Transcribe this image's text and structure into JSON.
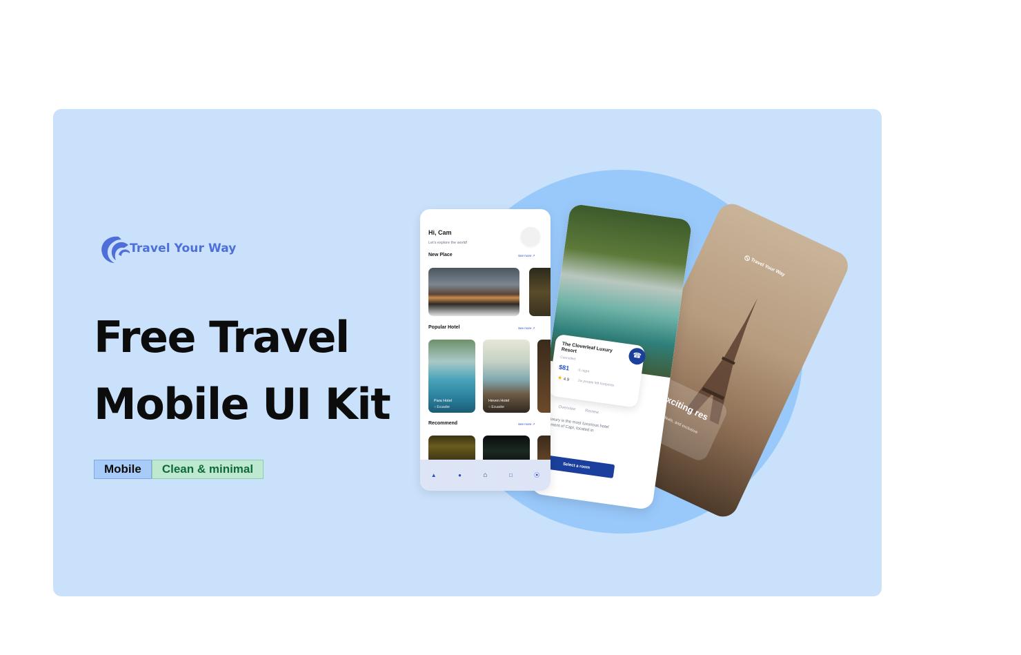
{
  "brand": {
    "name": "Travel Your Way",
    "accent": "#4e6fd9"
  },
  "headline": {
    "line1": "Free Travel",
    "line2": "Mobile UI Kit"
  },
  "tags": [
    {
      "label": "Mobile",
      "bg": "#a9cbf8"
    },
    {
      "label": "Clean & minimal",
      "bg": "#bfe8d0"
    }
  ],
  "phone_home": {
    "greeting": "Hi, Cam",
    "subtitle": "Let's explore the world!",
    "see_more": "See more",
    "sections": {
      "new_place": "New Place",
      "popular_hotel": "Popular Hotel",
      "recommend": "Recommend"
    },
    "popular_hotels": [
      {
        "name": "Para Hotel",
        "location": "Ecuador"
      },
      {
        "name": "Heven Hotel",
        "location": "Ecuador"
      }
    ],
    "nav": [
      "bell-icon",
      "profile-icon",
      "home-icon",
      "bookmark-icon",
      "compass-icon"
    ]
  },
  "phone_detail": {
    "hotel_name": "The Cloverleaf Luxury Resort",
    "location": "Cancelled",
    "price": "$81",
    "per_night": "/1 night",
    "rating": "4.9",
    "footprints": "2w people left footprints",
    "tabs": [
      "il",
      "Overview",
      "Review"
    ],
    "description": "k Luxury is the most luxurious hotel segment of Capi, located in",
    "cta": "Select a room"
  },
  "phone_splash": {
    "logo": "Travel Your Way",
    "title": "ore Exciting res",
    "subtitle": "nd the best deals, and exclusive travels with"
  },
  "colors": {
    "card_bg": "#c9e1fa",
    "circle": "#99c9fb",
    "primary": "#1b3f9c"
  }
}
